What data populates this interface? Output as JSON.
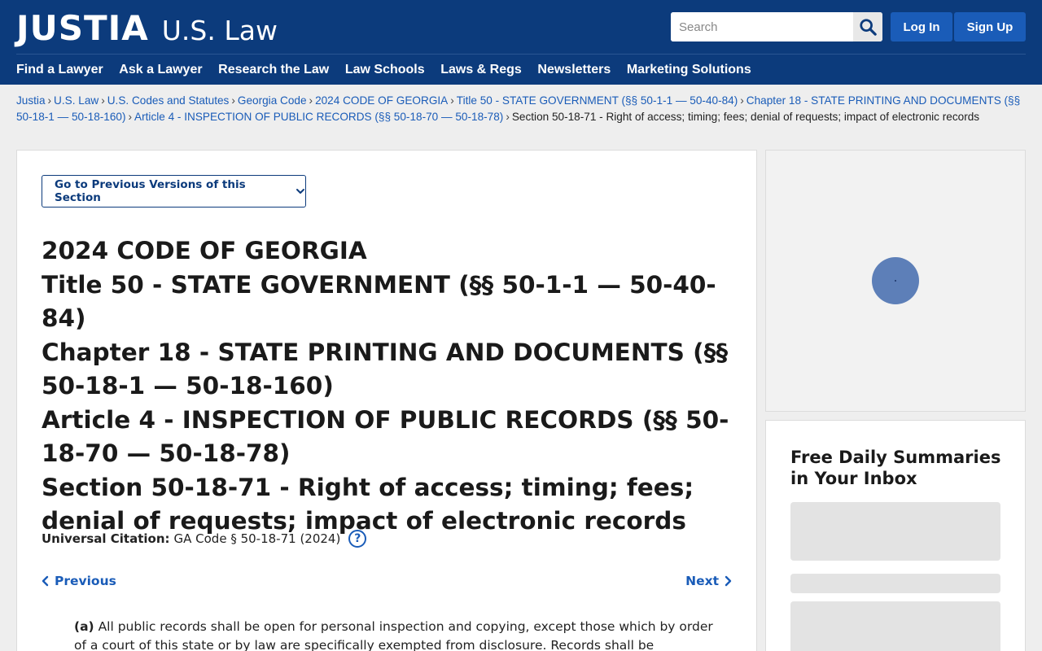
{
  "header": {
    "logo_main": "JUSTIA",
    "logo_sub": "U.S. Law",
    "search_placeholder": "Search",
    "login_label": "Log In",
    "signup_label": "Sign Up",
    "nav": [
      "Find a Lawyer",
      "Ask a Lawyer",
      "Research the Law",
      "Law Schools",
      "Laws & Regs",
      "Newsletters",
      "Marketing Solutions"
    ]
  },
  "breadcrumb": {
    "items": [
      "Justia",
      "U.S. Law",
      "U.S. Codes and Statutes",
      "Georgia Code",
      "2024 CODE OF GEORGIA",
      "Title 50 - STATE GOVERNMENT (§§ 50-1-1 — 50-40-84)",
      "Chapter 18 - STATE PRINTING AND DOCUMENTS (§§ 50-18-1 — 50-18-160)",
      "Article 4 - INSPECTION OF PUBLIC RECORDS (§§ 50-18-70 — 50-18-78)"
    ],
    "current": "Section 50-18-71 - Right of access; timing; fees; denial of requests; impact of electronic records",
    "separator": "›"
  },
  "main": {
    "versions_button": "Go to Previous Versions of this Section",
    "title_lines": [
      "2024 CODE OF GEORGIA",
      "Title 50 - STATE GOVERNMENT (§§ 50-1-1 — 50-40-84)",
      "Chapter 18 - STATE PRINTING AND DOCUMENTS (§§ 50-18-1 — 50-18-160)",
      "Article 4 - INSPECTION OF PUBLIC RECORDS (§§ 50-18-70 — 50-18-78)",
      "Section 50-18-71 - Right of access; timing; fees; denial of requests; impact of electronic records"
    ],
    "citation_label": "Universal Citation:",
    "citation_value": "GA Code § 50-18-71 (2024)",
    "help_glyph": "?",
    "previous_label": "Previous",
    "next_label": "Next",
    "paragraph_marker": "(a)",
    "paragraph_text": "All public records shall be open for personal inspection and copying, except those which by order of a court of this state or by law are specifically exempted from disclosure. Records shall be maintained by"
  },
  "sidebar": {
    "newsletter_title": "Free Daily Summaries in Your Inbox"
  },
  "colors": {
    "header_bg": "#0c3b7c",
    "button_blue": "#1a5cb8",
    "link_blue": "#1a5cb8"
  },
  "icons": {
    "search": "search-icon",
    "chevron_down": "chevron-down-icon",
    "chevron_left": "chevron-left-icon",
    "chevron_right": "chevron-right-icon",
    "help": "help-icon"
  }
}
